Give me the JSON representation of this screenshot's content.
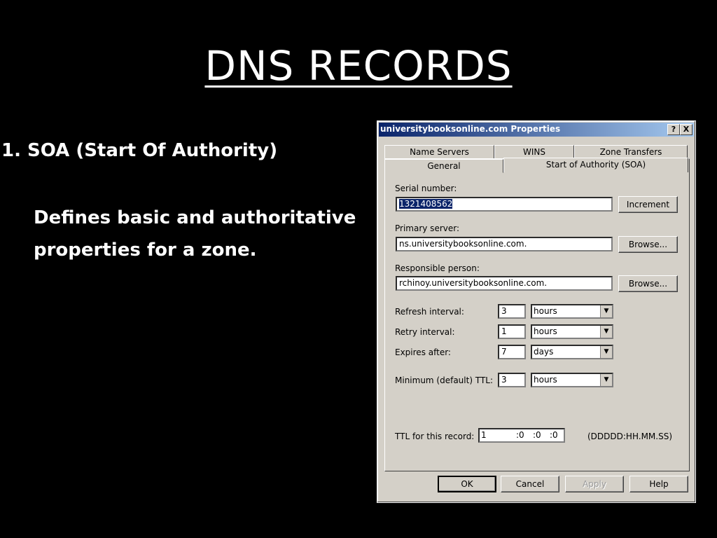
{
  "slide": {
    "title": "DNS RECORDS",
    "bullet": "1. SOA (Start Of Authority)",
    "desc_line1": "Defines basic and authoritative",
    "desc_line2": "properties for a zone."
  },
  "dialog": {
    "title": "universitybooksonline.com Properties",
    "help_btn": "?",
    "close_btn": "X",
    "tabs_back": [
      "Name Servers",
      "WINS",
      "Zone Transfers"
    ],
    "tabs_front": [
      "General",
      "Start of Authority (SOA)"
    ],
    "active_tab": "Start of Authority (SOA)",
    "serial_label": "Serial number:",
    "serial_value": "1321408562",
    "increment_label": "Increment",
    "primary_label": "Primary server:",
    "primary_value": "ns.universitybooksonline.com.",
    "browse_label": "Browse...",
    "responsible_label": "Responsible person:",
    "responsible_value": "rchinoy.universitybooksonline.com.",
    "refresh_label": "Refresh interval:",
    "refresh_value": "3",
    "refresh_unit": "hours",
    "retry_label": "Retry interval:",
    "retry_value": "1",
    "retry_unit": "hours",
    "expires_label": "Expires after:",
    "expires_value": "7",
    "expires_unit": "days",
    "minttl_label": "Minimum (default) TTL:",
    "minttl_value": "3",
    "minttl_unit": "hours",
    "ttl_label": "TTL for this record:",
    "ttl_days": "1",
    "ttl_hh": ":0",
    "ttl_mm": ":0",
    "ttl_ss": ":0",
    "ttl_format": "(DDDDD:HH.MM.SS)",
    "ok": "OK",
    "cancel": "Cancel",
    "apply": "Apply",
    "help": "Help"
  }
}
